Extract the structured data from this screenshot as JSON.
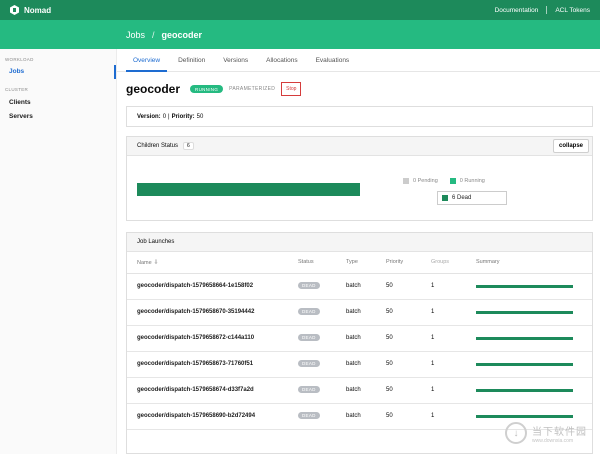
{
  "topbar": {
    "brand": "Nomad",
    "links": [
      "Documentation",
      "ACL Tokens"
    ]
  },
  "breadcrumb": {
    "parent": "Jobs",
    "separator": "/",
    "current": "geocoder"
  },
  "sidebar": {
    "sections": [
      {
        "label": "WORKLOAD",
        "items": [
          {
            "label": "Jobs",
            "active": true
          }
        ]
      },
      {
        "label": "CLUSTER",
        "items": [
          {
            "label": "Clients",
            "active": false
          },
          {
            "label": "Servers",
            "active": false
          }
        ]
      }
    ]
  },
  "tabs": [
    "Overview",
    "Definition",
    "Versions",
    "Allocations",
    "Evaluations"
  ],
  "job": {
    "name": "geocoder",
    "status": "RUNNING",
    "tag": "PARAMETERIZED",
    "stop_label": "Stop",
    "version_label": "Version:",
    "version": "0",
    "priority_label": "Priority:",
    "priority": "50"
  },
  "children": {
    "title": "Children Status",
    "count": "6",
    "collapse_label": "collapse",
    "dead_fraction": 1.0,
    "legend": [
      {
        "label": "0 Pending",
        "color": "#cccccc"
      },
      {
        "label": "0 Running",
        "color": "#25ba81"
      },
      {
        "label": "6 Dead",
        "color": "#1d8a5b"
      }
    ]
  },
  "launches": {
    "title": "Job Launches",
    "columns": [
      "Name",
      "Status",
      "Type",
      "Priority",
      "Groups",
      "Summary"
    ],
    "rows": [
      {
        "name": "geocoder/dispatch-1579658664-1e158f02",
        "status": "DEAD",
        "type": "batch",
        "priority": "50",
        "groups": "1"
      },
      {
        "name": "geocoder/dispatch-1579658670-35194442",
        "status": "DEAD",
        "type": "batch",
        "priority": "50",
        "groups": "1"
      },
      {
        "name": "geocoder/dispatch-1579658672-c144a110",
        "status": "DEAD",
        "type": "batch",
        "priority": "50",
        "groups": "1"
      },
      {
        "name": "geocoder/dispatch-1579658673-71760f51",
        "status": "DEAD",
        "type": "batch",
        "priority": "50",
        "groups": "1"
      },
      {
        "name": "geocoder/dispatch-1579658674-d33f7a2d",
        "status": "DEAD",
        "type": "batch",
        "priority": "50",
        "groups": "1"
      },
      {
        "name": "geocoder/dispatch-1579658690-b2d72494",
        "status": "DEAD",
        "type": "batch",
        "priority": "50",
        "groups": "1"
      }
    ]
  },
  "colors": {
    "brand_dark": "#1d8a5b",
    "brand_light": "#25ba81",
    "link_active": "#1e6cd1",
    "danger": "#d53c3c"
  },
  "watermark": {
    "title": "当下软件园",
    "url": "www.downxia.com"
  }
}
